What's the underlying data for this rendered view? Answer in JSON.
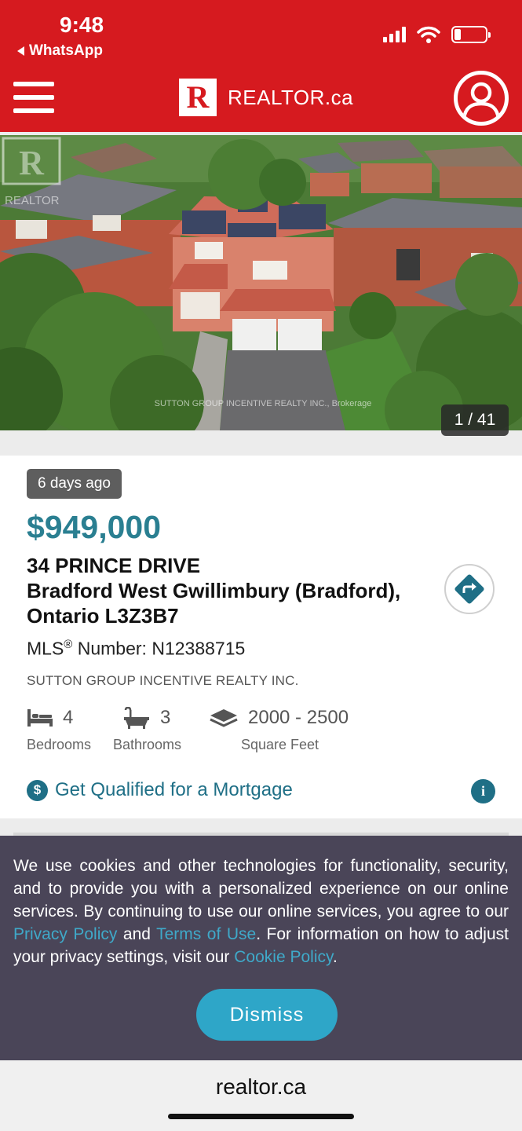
{
  "status_bar": {
    "time": "9:48",
    "back_app": "WhatsApp",
    "battery_level": 0.2
  },
  "header": {
    "logo_letter": "R",
    "logo_text": "REALTOR.ca",
    "brand_color": "#d61a1f",
    "menu_icon": "hamburger-icon",
    "profile_icon": "user-profile-icon"
  },
  "gallery": {
    "watermark": "SUTTON GROUP INCENTIVE REALTY INC., Brokerage",
    "realtor_watermark": "REALTOR",
    "counter": "1 / 41"
  },
  "listing": {
    "posted": "6 days ago",
    "price": "$949,000",
    "address_line1": "34 PRINCE DRIVE",
    "address_line2": "Bradford West Gwillimbury (Bradford),",
    "address_line3": "Ontario L3Z3B7",
    "mls_label": "MLS",
    "mls_reg": "®",
    "mls_number": " Number: N12388715",
    "brokerage": "SUTTON GROUP INCENTIVE REALTY INC.",
    "features": {
      "bedrooms": {
        "value": "4",
        "label": "Bedrooms"
      },
      "bathrooms": {
        "value": "3",
        "label": "Bathrooms"
      },
      "sqft": {
        "value": "2000 - 2500",
        "label": "Square Feet"
      }
    },
    "mortgage_link": "Get Qualified for a Mortgage",
    "accent_color": "#2a7f91"
  },
  "cookie": {
    "text_1": "We use cookies and other technologies for functionality, security, and to provide you with a personalized experience on our online services. By continuing to use our online services, you agree to our ",
    "privacy_link": "Privacy Policy",
    "text_2": " and ",
    "terms_link": "Terms of Use",
    "text_3": ". For information on how to adjust your privacy settings, visit our ",
    "cookie_link": "Cookie Policy",
    "text_4": ".",
    "dismiss_label": "Dismiss"
  },
  "browser": {
    "url": "realtor.ca"
  }
}
